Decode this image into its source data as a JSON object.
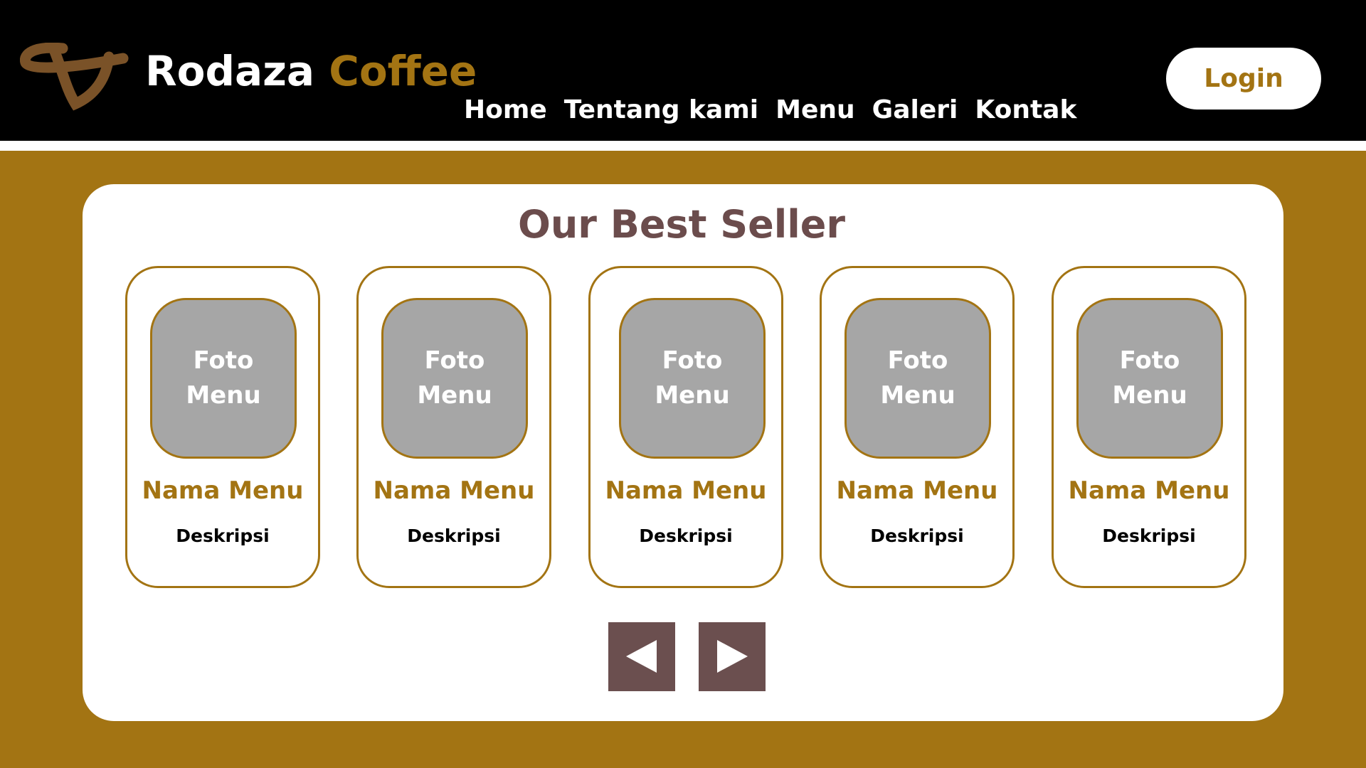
{
  "header": {
    "brand_main": "Rodaza",
    "brand_accent": "Coffee",
    "logo_icon": "coffee-logo-icon",
    "nav": [
      {
        "label": "Home"
      },
      {
        "label": "Tentang kami"
      },
      {
        "label": "Menu"
      },
      {
        "label": "Galeri"
      },
      {
        "label": "Kontak"
      }
    ],
    "login_label": "Login"
  },
  "best_seller": {
    "title": "Our Best Seller",
    "items": [
      {
        "photo_label": "Foto\nMenu",
        "name": "Nama Menu",
        "description": "Deskripsi"
      },
      {
        "photo_label": "Foto\nMenu",
        "name": "Nama Menu",
        "description": "Deskripsi"
      },
      {
        "photo_label": "Foto\nMenu",
        "name": "Nama Menu",
        "description": "Deskripsi"
      },
      {
        "photo_label": "Foto\nMenu",
        "name": "Nama Menu",
        "description": "Deskripsi"
      },
      {
        "photo_label": "Foto\nMenu",
        "name": "Nama Menu",
        "description": "Deskripsi"
      }
    ],
    "prev_icon": "arrow-left-icon",
    "next_icon": "arrow-right-icon"
  },
  "colors": {
    "gold": "#a37413",
    "header_bg": "#000000",
    "title_brown": "#6b4c4c",
    "button_brown": "#6b4f4f",
    "photo_gray": "#a6a6a6"
  }
}
